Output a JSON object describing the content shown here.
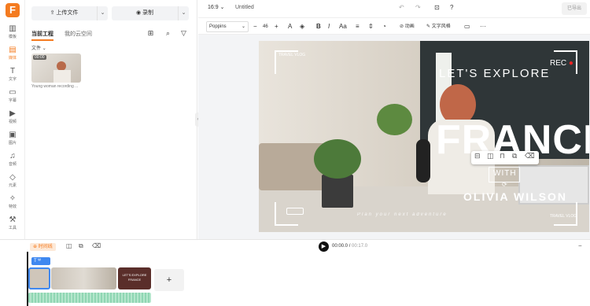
{
  "app": {
    "logo_letter": "F",
    "accent": "#f47b20"
  },
  "rail": [
    {
      "icon": "layout-icon",
      "label": "模板"
    },
    {
      "icon": "media-icon",
      "label": "媒体",
      "active": true
    },
    {
      "icon": "text-icon",
      "label": "文字"
    },
    {
      "icon": "subtitle-icon",
      "label": "字幕"
    },
    {
      "icon": "video-icon",
      "label": "视频"
    },
    {
      "icon": "image-icon",
      "label": "图片"
    },
    {
      "icon": "music-icon",
      "label": "音频"
    },
    {
      "icon": "element-icon",
      "label": "元素"
    },
    {
      "icon": "effects-icon",
      "label": "特效"
    },
    {
      "icon": "tools-icon",
      "label": "工具"
    }
  ],
  "left": {
    "upload_label": "上传文件",
    "record_label": "录制",
    "tabs": [
      "当前工程",
      "我的云空间"
    ],
    "folder_label": "文件",
    "media": {
      "duration": "00:00",
      "caption": "Young woman recording ..."
    }
  },
  "topbar": {
    "ratio": "16:9",
    "title": "Untitled",
    "export_label": "已导出"
  },
  "textbar": {
    "font": "Poppins",
    "size": "46",
    "motion_label": "动画",
    "style_label": "文字风格"
  },
  "canvas": {
    "corner_tl": "TRAVEL VLOG",
    "rec": "REC",
    "headline": "LET'S EXPLORE",
    "big": "FRANCE",
    "with": "WITH",
    "name": "OLIVIA WILSON",
    "script_line": "Plan your next adventure",
    "corner_br": "TRAVEL VLOG"
  },
  "timeline": {
    "autoscale_label": "时间线",
    "current_time": "00:00.0",
    "total_time": "00:17.0",
    "text_track_label": "T",
    "clip3_line1": "LET'S EXPLORE",
    "clip3_line2": "FRANCE",
    "add_label": "+"
  }
}
